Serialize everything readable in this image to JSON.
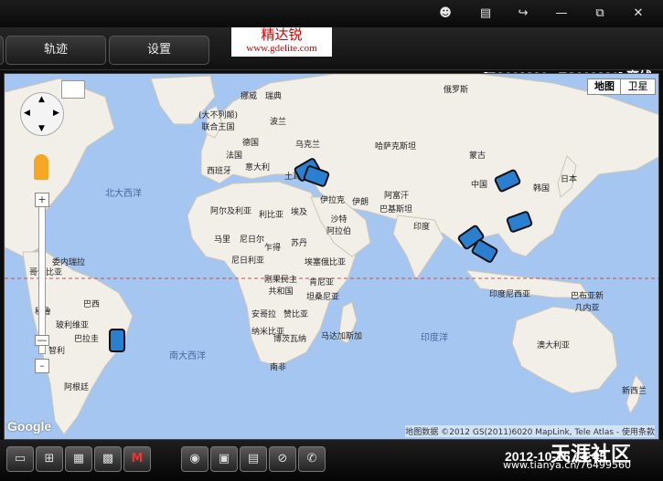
{
  "toolbar": {
    "track_label": "轨迹",
    "settings_label": "设置"
  },
  "logo": {
    "cn": "精达锐",
    "url": "www.gdelite.com"
  },
  "device_status": "[TC002826 - TC002826] 离线",
  "map": {
    "type_buttons": [
      "地图",
      "卫星"
    ],
    "attribution": "地图数据 ©2012 GS(2011)6020 MapLink, Tele Atlas - 使用条款",
    "google": "Google",
    "labels": {
      "russia": "俄罗斯",
      "norway": "挪威",
      "sweden": "瑞典",
      "uk": "(大不列颠)\n联合王国",
      "poland": "波兰",
      "germany": "德国",
      "ukraine": "乌克兰",
      "france": "法国",
      "italy": "意大利",
      "spain": "西班牙",
      "kazakhstan": "哈萨克斯坦",
      "mongolia": "蒙古",
      "turkey": "土耳其",
      "iran": "伊朗",
      "iraq": "伊拉克",
      "afghanistan": "阿富汗",
      "pakistan": "巴基斯坦",
      "china": "中国",
      "korea": "韩国",
      "japan": "日本",
      "algeria": "阿尔及利亚",
      "libya": "利比亚",
      "egypt": "埃及",
      "saudi": "沙特\n阿拉伯",
      "india": "印度",
      "mali": "马里",
      "niger": "尼日尔",
      "chad": "乍得",
      "sudan": "苏丹",
      "nigeria": "尼日利亚",
      "ethiopia": "埃塞俄比亚",
      "kenya": "肯尼亚",
      "drc": "刚果民主\n共和国",
      "tanzania": "坦桑尼亚",
      "angola": "安哥拉",
      "zambia": "赞比亚",
      "namibia": "纳米比亚",
      "botswana": "博茨瓦纳",
      "south_africa": "南非",
      "madagascar": "马达加斯加",
      "indonesia": "印度尼西亚",
      "png": "巴布亚新\n几内亚",
      "australia": "澳大利亚",
      "new_zealand": "新西兰",
      "venezuela": "委内瑞拉",
      "colombia": "哥伦比亚",
      "peru": "秘鲁",
      "brazil": "巴西",
      "bolivia": "玻利维亚",
      "paraguay": "巴拉圭",
      "chile": "智利",
      "argentina": "阿根廷",
      "atlantic_n": "北大西洋",
      "atlantic_s": "南大西洋",
      "indian": "印度洋"
    }
  },
  "datetime": "2012-10-16 14:45",
  "watermark": {
    "text": "天涯社区",
    "url": "www.tianya.cn/76499560"
  }
}
